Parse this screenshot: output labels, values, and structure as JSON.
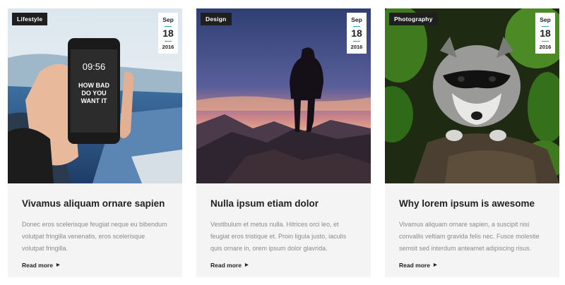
{
  "cards": [
    {
      "category": "Lifestyle",
      "date": {
        "month": "Sep",
        "day": "18",
        "year": "2016"
      },
      "title": "Vivamus aliquam ornare sapien",
      "excerpt": "Donec eros scelerisque feugiat neque eu bibendum volutpat fringilla venenatis, eros scelerisque volutpat fringilla.",
      "link": "Read more",
      "phone_text": {
        "time": "09:56",
        "line1": "HOW BAD",
        "line2": "DO YOU",
        "line3": "WANT IT"
      }
    },
    {
      "category": "Design",
      "date": {
        "month": "Sep",
        "day": "18",
        "year": "2016"
      },
      "title": "Nulla ipsum etiam dolor",
      "excerpt": "Vestibulum et metus nulla. Hitrices orci leo, et feugiat eros tristique et. Proin ligula justo, iaculis quis ornare in, orem ipsum dolor glavrida.",
      "link": "Read more"
    },
    {
      "category": "Photography",
      "date": {
        "month": "Sep",
        "day": "18",
        "year": "2016"
      },
      "title": "Why lorem ipsum is awesome",
      "excerpt": "Vivamus aliquam ornare sapien, a suscipit nisi convallis veltiam gravida felis nec. Fusce molestie semsit sed interdum anteamet adipiscing risus.",
      "link": "Read more"
    }
  ],
  "colors": {
    "accent": "#2aa7b8",
    "tag_bg": "#1f1f1f",
    "card_bg": "#f4f4f4"
  }
}
